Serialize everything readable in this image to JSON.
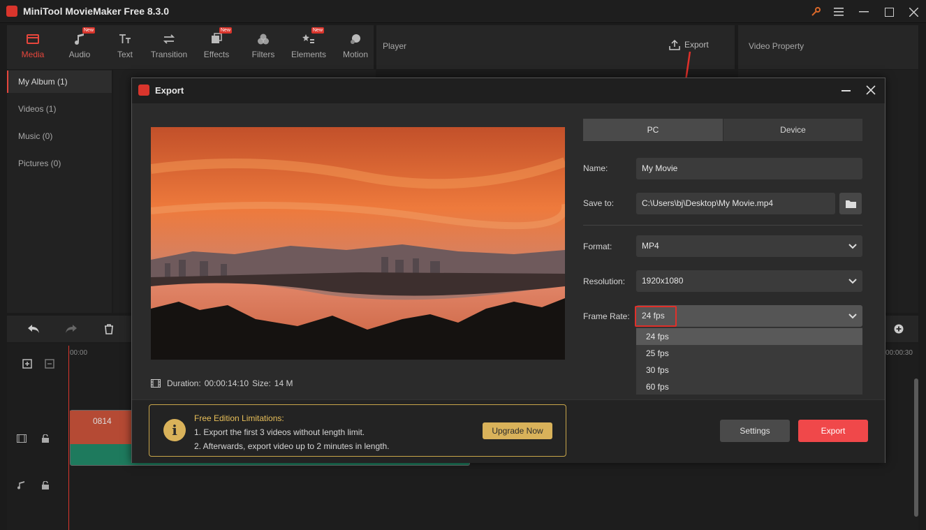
{
  "app": {
    "title": "MiniTool MovieMaker Free 8.3.0"
  },
  "toolbar": {
    "items": [
      {
        "label": "Media",
        "icon": "media-icon",
        "active": true,
        "new": false
      },
      {
        "label": "Audio",
        "icon": "music-note-icon",
        "active": false,
        "new": true
      },
      {
        "label": "Text",
        "icon": "text-icon",
        "active": false,
        "new": false
      },
      {
        "label": "Transition",
        "icon": "transition-icon",
        "active": false,
        "new": false
      },
      {
        "label": "Effects",
        "icon": "effects-icon",
        "active": false,
        "new": true
      },
      {
        "label": "Filters",
        "icon": "filters-icon",
        "active": false,
        "new": false
      },
      {
        "label": "Elements",
        "icon": "elements-icon",
        "active": false,
        "new": true
      },
      {
        "label": "Motion",
        "icon": "motion-icon",
        "active": false,
        "new": false
      }
    ],
    "new_badge": "New"
  },
  "player": {
    "title": "Player",
    "export_label": "Export"
  },
  "property": {
    "title": "Video Property"
  },
  "sidebar": {
    "items": [
      {
        "label": "My Album (1)",
        "active": true
      },
      {
        "label": "Videos (1)",
        "active": false
      },
      {
        "label": "Music (0)",
        "active": false
      },
      {
        "label": "Pictures (0)",
        "active": false
      }
    ]
  },
  "timeline": {
    "ruler_start": "00:00",
    "ruler_end": "00:00:30",
    "clip_label": "0814"
  },
  "dialog": {
    "title": "Export",
    "tabs": [
      {
        "label": "PC",
        "active": true
      },
      {
        "label": "Device",
        "active": false
      }
    ],
    "name_label": "Name:",
    "name_value": "My Movie",
    "save_label": "Save to:",
    "save_value": "C:\\Users\\bj\\Desktop\\My Movie.mp4",
    "format_label": "Format:",
    "format_value": "MP4",
    "resolution_label": "Resolution:",
    "resolution_value": "1920x1080",
    "framerate_label": "Frame Rate:",
    "framerate_value": "24 fps",
    "framerate_options": [
      "24 fps",
      "25 fps",
      "30 fps",
      "60 fps"
    ],
    "duration_label": "Duration:",
    "duration_value": "00:00:14:10",
    "size_label": "Size:",
    "size_value": "14 M",
    "limits": {
      "title": "Free Edition Limitations:",
      "line1": "1. Export the first 3 videos without length limit.",
      "line2": "2. Afterwards, export video up to 2 minutes in length.",
      "upgrade_label": "Upgrade Now"
    },
    "settings_label": "Settings",
    "export_label": "Export"
  },
  "colors": {
    "accent": "#e6463c",
    "export": "#f0484a",
    "gold": "#d9b25a"
  }
}
